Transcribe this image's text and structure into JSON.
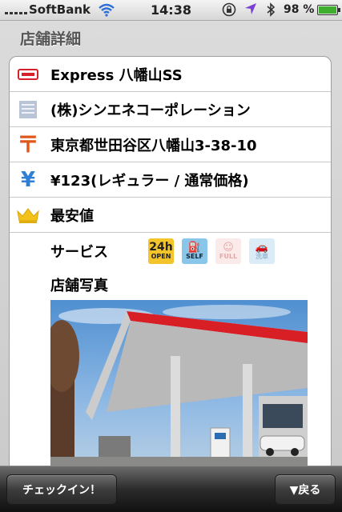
{
  "status_bar": {
    "carrier": "SoftBank",
    "time": "14:38",
    "battery_percent": "98 %",
    "battery_level": 0.98
  },
  "page": {
    "title": "店舗詳細"
  },
  "details": {
    "station_name": "Express 八幡山SS",
    "company": "(株)シンエネコーポレーション",
    "address": "東京都世田谷区八幡山3-38-10",
    "price": "¥123(レギュラー / 通常価格)",
    "ranking": "最安値"
  },
  "services": {
    "label": "サービス",
    "badges": [
      {
        "name": "24h",
        "sub": "OPEN",
        "active": true
      },
      {
        "name": "SELF",
        "active": true
      },
      {
        "name": "FULL",
        "active": false
      },
      {
        "name": "洗車",
        "active": false
      }
    ]
  },
  "photo": {
    "label": "店舗写真"
  },
  "toolbar": {
    "checkin_label": "チェックイン！",
    "back_label": "▼戻る"
  },
  "colors": {
    "brand_red": "#d6212a",
    "postal_orange": "#e0571d",
    "yen_blue": "#2f7fd6",
    "crown_gold": "#f2c21b"
  }
}
